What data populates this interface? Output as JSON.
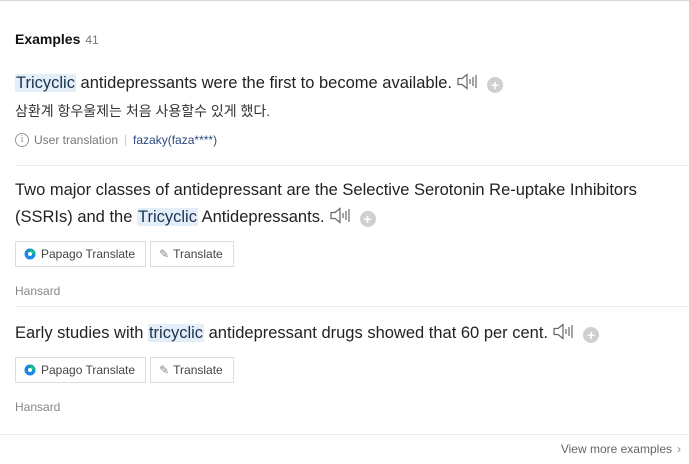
{
  "header": {
    "title": "Examples",
    "count": "41"
  },
  "examples": [
    {
      "parts": [
        "",
        "Tricyclic",
        " antidepressants were the first to become available."
      ],
      "translation": "삼환계 항우울제는 처음 사용할수 있게 했다.",
      "info_label": "User translation",
      "user": "fazaky(faza****)"
    },
    {
      "parts": [
        "Two major classes of antidepressant are the Selective Serotonin Re-uptake Inhibitors (SSRIs) and the ",
        "Tricyclic",
        " Antidepressants."
      ],
      "papago_label": "Papago Translate",
      "translate_label": "Translate",
      "source": "Hansard"
    },
    {
      "parts": [
        "Early studies with ",
        "tricyclic",
        " antidepressant drugs showed that 60 per cent."
      ],
      "papago_label": "Papago Translate",
      "translate_label": "Translate",
      "source": "Hansard"
    }
  ],
  "footer": {
    "more_label": "View more examples"
  },
  "icons": {
    "speaker": "speaker-icon",
    "plus": "add-icon",
    "info": "info-icon",
    "papago": "papago-icon",
    "pencil": "pencil-icon",
    "chevron": "chevron-right-icon"
  },
  "colors": {
    "highlight": "#e3eef9",
    "papago_green": "#19ce60",
    "papago_blue": "#1a88e5"
  }
}
